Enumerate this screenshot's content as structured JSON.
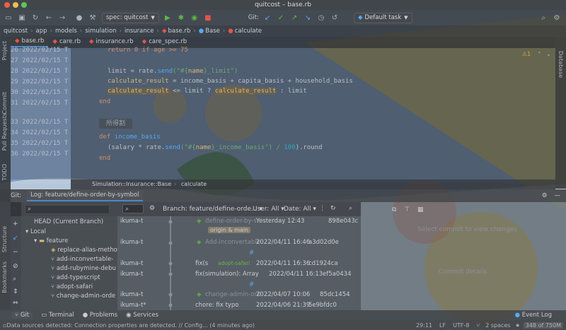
{
  "window": {
    "title": "quitcost – base.rb"
  },
  "toolbar": {
    "run_config": "spec: quitcost",
    "git_label": "Git:",
    "default_task": "Default task"
  },
  "breadcrumb": [
    "quitcost",
    "app",
    "models",
    "simulation",
    "insurance",
    "base.rb",
    "Base",
    "calculate"
  ],
  "tabs": [
    {
      "label": "base.rb",
      "active": true
    },
    {
      "label": "care.rb",
      "active": false
    },
    {
      "label": "insurance.rb",
      "active": false
    },
    {
      "label": "care_spec.rb",
      "active": false
    }
  ],
  "left_stripe": [
    "Project",
    "Commit",
    "Pull Requests",
    "TODO"
  ],
  "left_stripe_bottom": [
    "Structure",
    "Bookmarks"
  ],
  "right_stripe": [
    "Database"
  ],
  "editor": {
    "warning_count": "1",
    "gutter": [
      {
        "line": "26",
        "date": "2022/02/15",
        "author": "T"
      },
      {
        "line": "27",
        "date": "2022/02/15",
        "author": "T"
      },
      {
        "line": "28",
        "date": "2022/02/15",
        "author": "T"
      },
      {
        "line": "29",
        "date": "2022/02/15",
        "author": "T"
      },
      {
        "line": "30",
        "date": "2022/02/15",
        "author": "T"
      },
      {
        "line": "31",
        "date": "2022/02/15",
        "author": "T"
      },
      {
        "line": "33",
        "date": "2022/02/15",
        "author": "T"
      },
      {
        "line": "34",
        "date": "2022/02/15",
        "author": "T"
      },
      {
        "line": "35",
        "date": "2022/02/15",
        "author": "T"
      },
      {
        "line": "36",
        "date": "2022/02/15",
        "author": "T"
      }
    ],
    "lines": {
      "l0": "return 0 if age >= 75",
      "l1a": "limit",
      "l1b": " = rate.",
      "l1c": "send",
      "l1d": "(\"#{",
      "l1e": "name",
      "l1f": "}_limit\")",
      "l2a": "calculate_result",
      "l2b": " = income_basis + capita_basis + household_basis",
      "l3a": "calculate_result",
      "l3b": " <= limit ? ",
      "l3c": "calculate_result",
      "l3d": " : limit",
      "l4": "end",
      "doc": "所得割",
      "l5a": "def ",
      "l5b": "income_basis",
      "l6a": "(salary * rate.",
      "l6b": "send",
      "l6c": "(\"#{",
      "l6d": "name",
      "l6e": "}_income_basis\") / ",
      "l6f": "100",
      "l6g": ").round",
      "l7": "end"
    },
    "breadcrumb": [
      "Simulation::Insurance::Base",
      "calculate"
    ]
  },
  "git_panel": {
    "label": "Git:",
    "log_tab": "Log: feature/define-order-by-symbol",
    "branch_filter": "Branch: feature/define-orde...",
    "user_filter": "User: All",
    "date_filter": "Date: All",
    "tree": {
      "head": "HEAD (Current Branch)",
      "local": "Local",
      "feature": "feature",
      "branches": [
        "replace-alias-metho",
        "add-inconvertable-",
        "add-rubymine-debu",
        "add-typescript",
        "adopt-safari",
        "change-admin-orde"
      ]
    },
    "commits": [
      {
        "author": "ikuma-t",
        "message": "define-order-by-s",
        "tag": "origin & main",
        "date": "Yesterday 12:43",
        "hash": "898e043c"
      },
      {
        "author": "ikuma-t",
        "message": "Add-inconvertable",
        "tag": "",
        "date": "2022/04/11 16:46",
        "hash": "a3d02d0e"
      },
      {
        "author": "",
        "message": "#",
        "tag": "",
        "date": "",
        "hash": ""
      },
      {
        "author": "ikuma-t",
        "message": "fix(s",
        "tag": "adopt-safari",
        "date": "2022/04/11 16:36",
        "hash": "cd1924ca"
      },
      {
        "author": "ikuma-t",
        "message": "fix(simulation): Array",
        "tag": "",
        "date": "2022/04/11 16:13",
        "hash": "ef5a0434"
      },
      {
        "author": "",
        "message": "#",
        "tag": "",
        "date": "",
        "hash": ""
      },
      {
        "author": "ikuma-t",
        "message": "change-admin-ord",
        "tag": "",
        "date": "2022/04/07 10:06",
        "hash": "85dc1454"
      },
      {
        "author": "ikuma-t*",
        "message": "chore: fix typo",
        "tag": "",
        "date": "2022/04/06 21:39",
        "hash": "5e9bfdc0"
      }
    ],
    "detail": {
      "placeholder": "Select commit to view changes",
      "commit_details": "Commit details"
    }
  },
  "bottom_tabs": [
    "Git",
    "Terminal",
    "Problems",
    "Services"
  ],
  "event_log": "Event Log",
  "status": {
    "message": "Data sources detected: Connection properties are detected. // Config... (4 minutes ago)",
    "position": "29:11",
    "line_sep": "LF",
    "encoding": "UTF-8",
    "indent": "2 spaces",
    "memory": "348 of 750M"
  },
  "colors": {
    "accent": "#4a88c7",
    "run_green": "#5fb84a",
    "error_red": "#e5534b"
  }
}
